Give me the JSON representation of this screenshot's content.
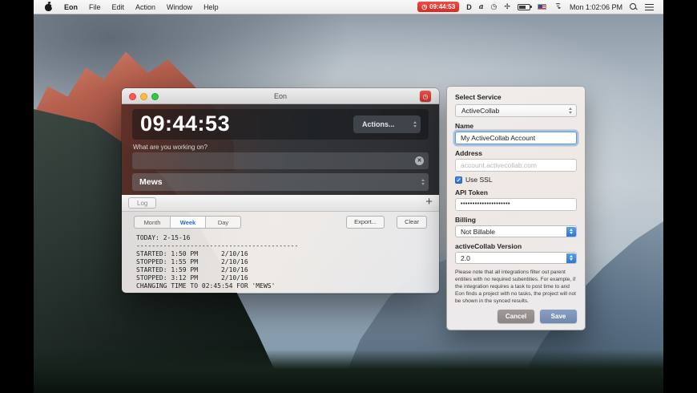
{
  "menubar": {
    "app": "Eon",
    "menus": [
      "File",
      "Edit",
      "Action",
      "Window",
      "Help"
    ],
    "badge_time": "09:44:53",
    "status_time": "Mon 1:02:06 PM",
    "icons": {
      "d": "D",
      "a": "a",
      "history": "◷",
      "fan": "✢"
    }
  },
  "window": {
    "title": "Eon",
    "timer": "09:44:53",
    "actions_label": "Actions...",
    "working_label": "What are you working on?",
    "task_value": "",
    "project": "Mews",
    "log_tab": "Log",
    "segments": [
      "Month",
      "Week",
      "Day"
    ],
    "selected_segment": "Week",
    "export_label": "Export...",
    "clear_label": "Clear",
    "log_text": "TODAY: 2-15-16\n------------------------------------------\nSTARTED: 1:50 PM      2/10/16\nSTOPPED: 1:55 PM      2/10/16\nSTARTED: 1:59 PM      2/10/16\nSTOPPED: 3:12 PM      2/10/16\nCHANGING TIME TO 02:45:54 FOR 'MEWS'"
  },
  "popover": {
    "title": "Select Service",
    "service_value": "ActiveCollab",
    "name_label": "Name",
    "name_value": "My ActiveCollab Account",
    "address_label": "Address",
    "address_placeholder": "account.activecollab.com",
    "ssl_label": "Use SSL",
    "ssl_checked": true,
    "api_token_label": "API Token",
    "api_token_value": "•••••••••••••••••••••",
    "billing_label": "Billing",
    "billing_value": "Not Billable",
    "version_label": "activeCollab Version",
    "version_value": "2.0",
    "note": "Please note that all integrations filter out parent entities with no required subentities. For example, if the integration requires a task to post time to and Eon finds a project with no tasks, the project will not be shown in the synced results.",
    "cancel_label": "Cancel",
    "save_label": "Save"
  },
  "icons": {
    "plus": "+",
    "clear": "✕",
    "check": "✓",
    "clock": "◷"
  },
  "colors": {
    "accent_red": "#e23b36",
    "focus_blue": "#5f97d8",
    "stepper_blue": "#2e74d6",
    "save_blue": "#7088ad",
    "segment_selected_blue": "#2e6bcc"
  }
}
